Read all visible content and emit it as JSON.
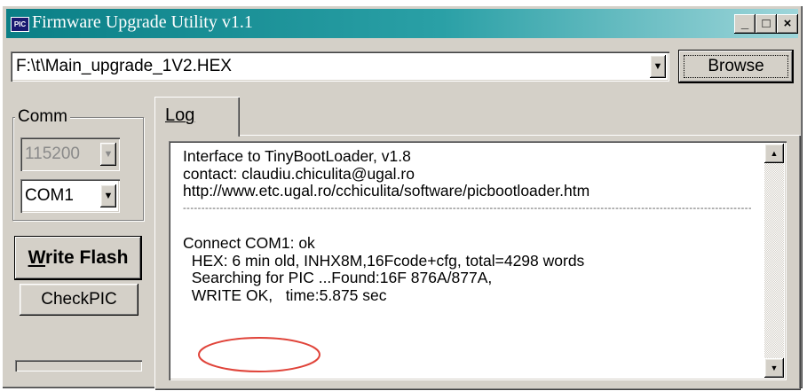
{
  "window": {
    "title": "Firmware Upgrade Utility v1.1",
    "app_icon_text": "PIC",
    "controls": {
      "minimize": "_",
      "maximize": "□",
      "close": "×"
    }
  },
  "file": {
    "path": "F:\\t\\Main_upgrade_1V2.HEX",
    "browse_label": "Browse"
  },
  "comm": {
    "group_label": "Comm",
    "baud_rate": "115200",
    "port": "COM1"
  },
  "actions": {
    "write_flash_label": "Write Flash",
    "write_flash_hotkey": "W",
    "check_pic_label": "CheckPIC"
  },
  "tabs": [
    {
      "label": "Log",
      "hotkey": "L",
      "active": true
    }
  ],
  "log": {
    "lines": [
      "Interface to TinyBootLoader, v1.8",
      "contact: claudiu.chiculita@ugal.ro",
      "http://www.etc.ugal.ro/cchiculita/software/picbootloader.htm",
      "----------------------------------------------------------------------------------------------------------------------------------------------------------------------------",
      "",
      "Connect COM1: ok",
      "  HEX: 6 min old, INHX8M,16Fcode+cfg, total=4298 words",
      "  Searching for PIC ...Found:16F 876A/877A,",
      "  WRITE OK,   time:5.875 sec"
    ]
  },
  "colors": {
    "title_bar_start": "#0a7f86",
    "title_bar_end": "#9fd6da",
    "highlight_ellipse": "#e0443a"
  },
  "icons": {
    "dropdown": "chevron-down-icon",
    "scroll_up": "arrow-up-icon",
    "scroll_down": "arrow-down-icon"
  }
}
